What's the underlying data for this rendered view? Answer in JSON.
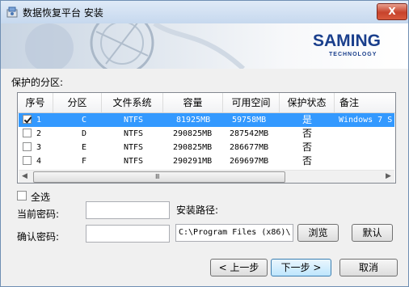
{
  "window": {
    "title": "数据恢复平台 安装",
    "close_label": "X"
  },
  "banner": {
    "logo_main": "SAMING",
    "logo_sub": "TECHNOLOGY"
  },
  "section_label": "保护的分区:",
  "table": {
    "columns": [
      "序号",
      "分区",
      "文件系统",
      "容量",
      "可用空间",
      "保护状态",
      "备注"
    ],
    "rows": [
      {
        "checked": true,
        "selected": true,
        "cells": [
          "1",
          "C",
          "NTFS",
          "81925MB",
          "59758MB",
          "是",
          "Windows 7 S"
        ]
      },
      {
        "checked": false,
        "selected": false,
        "cells": [
          "2",
          "D",
          "NTFS",
          "290825MB",
          "287542MB",
          "否",
          ""
        ]
      },
      {
        "checked": false,
        "selected": false,
        "cells": [
          "3",
          "E",
          "NTFS",
          "290825MB",
          "286677MB",
          "否",
          ""
        ]
      },
      {
        "checked": false,
        "selected": false,
        "cells": [
          "4",
          "F",
          "NTFS",
          "290291MB",
          "269697MB",
          "否",
          ""
        ]
      }
    ],
    "scroll_grip": "Ⅲ"
  },
  "select_all_label": "全选",
  "form": {
    "current_password_label": "当前密码:",
    "confirm_password_label": "确认密码:",
    "install_path_label": "安装路径:",
    "install_path_value": "C:\\Program Files (x86)\\",
    "browse_label": "浏览",
    "default_label": "默认"
  },
  "footer": {
    "back_label": "< 上一步",
    "next_label": "下一步 >",
    "cancel_label": "取消"
  }
}
